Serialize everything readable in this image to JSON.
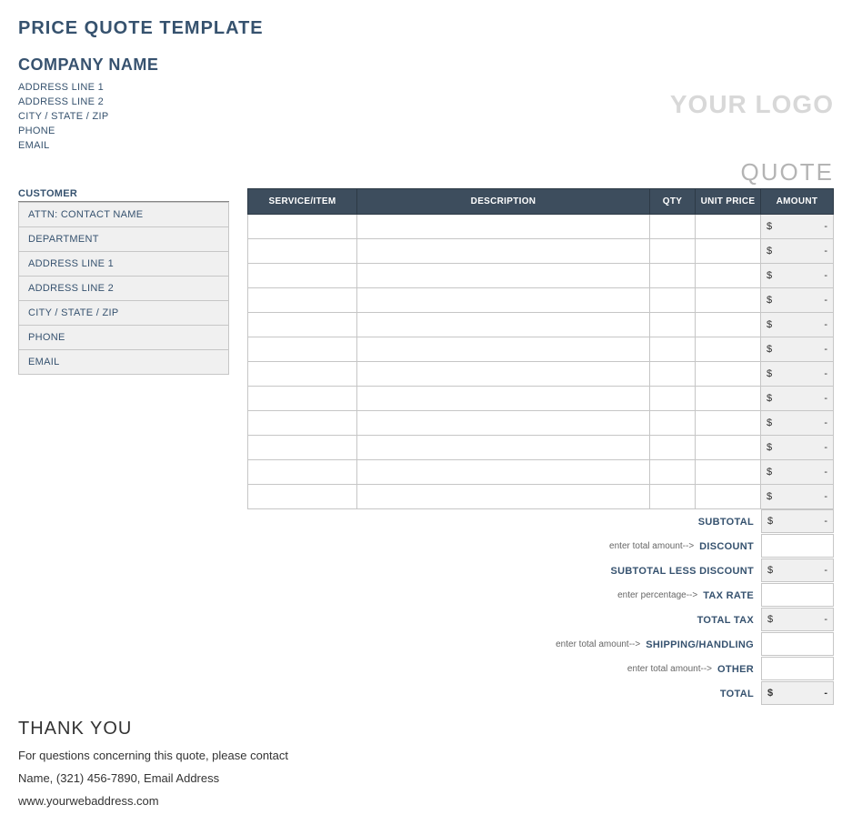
{
  "title": "PRICE QUOTE TEMPLATE",
  "logo_text": "YOUR LOGO",
  "quote_label": "QUOTE",
  "company": {
    "name": "COMPANY NAME",
    "lines": [
      "ADDRESS LINE 1",
      "ADDRESS LINE 2",
      "CITY / STATE / ZIP",
      "PHONE",
      "EMAIL"
    ]
  },
  "customer": {
    "heading": "CUSTOMER",
    "rows": [
      "ATTN: CONTACT NAME",
      "DEPARTMENT",
      "ADDRESS LINE 1",
      "ADDRESS LINE 2",
      "CITY / STATE / ZIP",
      "PHONE",
      "EMAIL"
    ]
  },
  "items": {
    "headers": {
      "service": "SERVICE/ITEM",
      "description": "DESCRIPTION",
      "qty": "QTY",
      "unit": "UNIT PRICE",
      "amount": "AMOUNT"
    },
    "row_count": 12,
    "amount_prefix": "$",
    "amount_value": "-"
  },
  "totals": [
    {
      "hint": "",
      "label": "SUBTOTAL",
      "shaded": true,
      "prefix": "$",
      "value": "-"
    },
    {
      "hint": "enter total amount-->",
      "label": "DISCOUNT",
      "shaded": false,
      "prefix": "",
      "value": ""
    },
    {
      "hint": "",
      "label": "SUBTOTAL LESS DISCOUNT",
      "shaded": true,
      "prefix": "$",
      "value": "-"
    },
    {
      "hint": "enter percentage-->",
      "label": "TAX RATE",
      "shaded": false,
      "prefix": "",
      "value": ""
    },
    {
      "hint": "",
      "label": "TOTAL TAX",
      "shaded": true,
      "prefix": "$",
      "value": "-"
    },
    {
      "hint": "enter total amount-->",
      "label": "SHIPPING/HANDLING",
      "shaded": false,
      "prefix": "",
      "value": ""
    },
    {
      "hint": "enter total amount-->",
      "label": "OTHER",
      "shaded": false,
      "prefix": "",
      "value": ""
    },
    {
      "hint": "",
      "label": "TOTAL",
      "shaded": true,
      "final": true,
      "prefix": "$",
      "value": "-"
    }
  ],
  "footer": {
    "thank_you": "THANK YOU",
    "line1": "For questions concerning this quote, please contact",
    "line2": "Name, (321) 456-7890, Email Address",
    "line3": "www.yourwebaddress.com"
  }
}
